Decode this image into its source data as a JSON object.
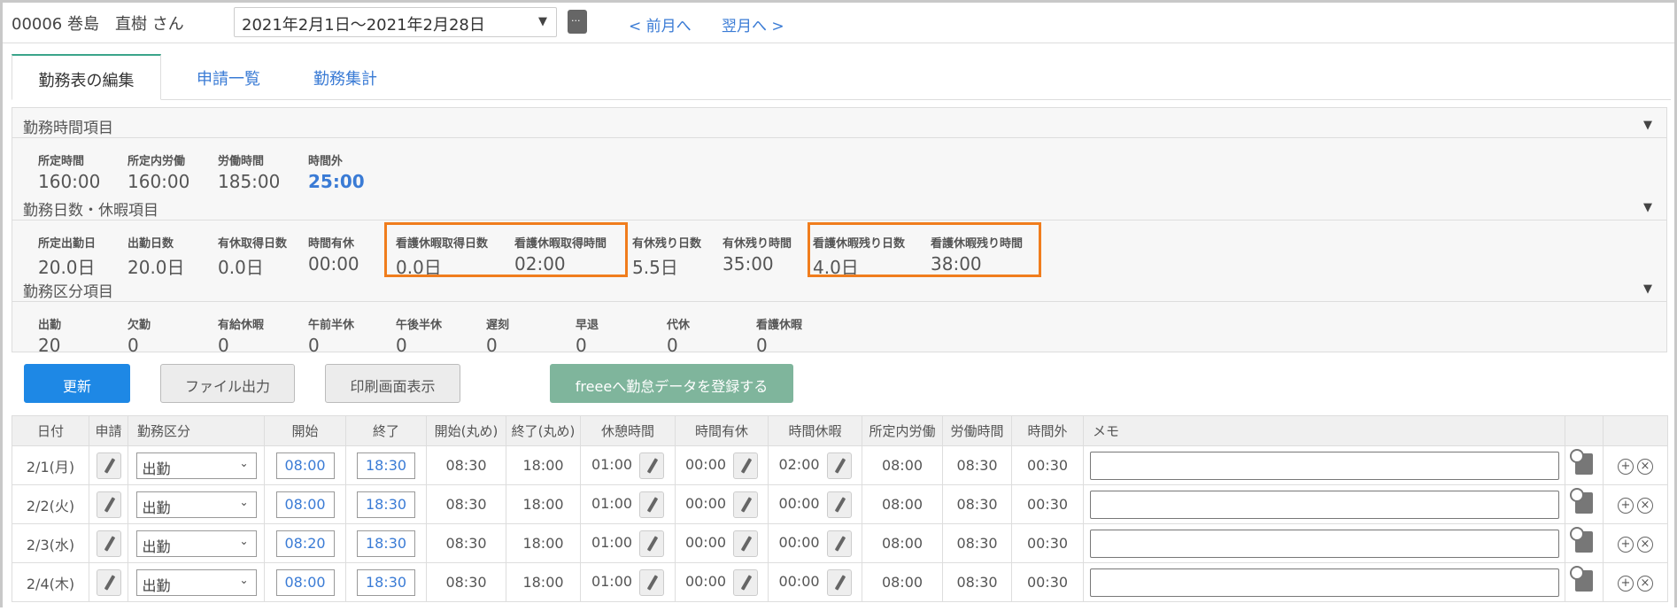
{
  "header": {
    "employee": "00006 巻島　直樹 さん",
    "period": "2021年2月1日～2021年2月28日",
    "prev": "< 前月へ",
    "next": "翌月へ >"
  },
  "tabs": [
    "勤務表の編集",
    "申請一覧",
    "勤務集計"
  ],
  "sections": [
    {
      "title": "勤務時間項目",
      "items": [
        {
          "label": "所定時間",
          "value": "160:00"
        },
        {
          "label": "所定内労働",
          "value": "160:00"
        },
        {
          "label": "労働時間",
          "value": "185:00"
        },
        {
          "label": "時間外",
          "value": "25:00",
          "highlight": true
        }
      ]
    },
    {
      "title": "勤務日数・休暇項目",
      "items": [
        {
          "label": "所定出勤日",
          "value": "20.0日"
        },
        {
          "label": "出勤日数",
          "value": "20.0日"
        },
        {
          "label": "有休取得日数",
          "value": "0.0日"
        },
        {
          "label": "時間有休",
          "value": "00:00"
        },
        {
          "label": "看護休暇取得日数",
          "value": "0.0日"
        },
        {
          "label": "看護休暇取得時間",
          "value": "02:00"
        },
        {
          "label": "有休残り日数",
          "value": "5.5日"
        },
        {
          "label": "有休残り時間",
          "value": "35:00"
        },
        {
          "label": "看護休暇残り日数",
          "value": "4.0日"
        },
        {
          "label": "看護休暇残り時間",
          "value": "38:00"
        }
      ]
    },
    {
      "title": "勤務区分項目",
      "items": [
        {
          "label": "出勤",
          "value": "20"
        },
        {
          "label": "欠勤",
          "value": "0"
        },
        {
          "label": "有給休暇",
          "value": "0"
        },
        {
          "label": "午前半休",
          "value": "0"
        },
        {
          "label": "午後半休",
          "value": "0"
        },
        {
          "label": "遅刻",
          "value": "0"
        },
        {
          "label": "早退",
          "value": "0"
        },
        {
          "label": "代休",
          "value": "0"
        },
        {
          "label": "看護休暇",
          "value": "0"
        }
      ]
    }
  ],
  "buttons": {
    "update": "更新",
    "file": "ファイル出力",
    "print": "印刷画面表示",
    "freee": "freeeへ勤怠データを登録する"
  },
  "colors": {
    "primary": "#1e88e5",
    "freee": "#7fb59c",
    "highlight": "#f07d1d",
    "link": "#3a7bd5"
  },
  "table": {
    "headers": [
      "日付",
      "申請",
      "勤務区分",
      "開始",
      "終了",
      "開始(丸め)",
      "終了(丸め)",
      "休憩時間",
      "時間有休",
      "時間休暇",
      "所定内労働",
      "労働時間",
      "時間外",
      "メモ",
      "",
      ""
    ],
    "rows": [
      {
        "date": "2/1(月)",
        "type": "出勤",
        "start": "08:00",
        "end": "18:30",
        "rstart": "08:30",
        "rend": "18:00",
        "break": "01:00",
        "paid": "00:00",
        "leave": "02:00",
        "scheduled": "08:00",
        "work": "08:30",
        "over": "00:30",
        "memo": ""
      },
      {
        "date": "2/2(火)",
        "type": "出勤",
        "start": "08:00",
        "end": "18:30",
        "rstart": "08:30",
        "rend": "18:00",
        "break": "01:00",
        "paid": "00:00",
        "leave": "00:00",
        "scheduled": "08:00",
        "work": "08:30",
        "over": "00:30",
        "memo": ""
      },
      {
        "date": "2/3(水)",
        "type": "出勤",
        "start": "08:20",
        "end": "18:30",
        "rstart": "08:30",
        "rend": "18:00",
        "break": "01:00",
        "paid": "00:00",
        "leave": "00:00",
        "scheduled": "08:00",
        "work": "08:30",
        "over": "00:30",
        "memo": ""
      },
      {
        "date": "2/4(木)",
        "type": "出勤",
        "start": "08:00",
        "end": "18:30",
        "rstart": "08:30",
        "rend": "18:00",
        "break": "01:00",
        "paid": "00:00",
        "leave": "00:00",
        "scheduled": "08:00",
        "work": "08:30",
        "over": "00:30",
        "memo": ""
      }
    ]
  }
}
